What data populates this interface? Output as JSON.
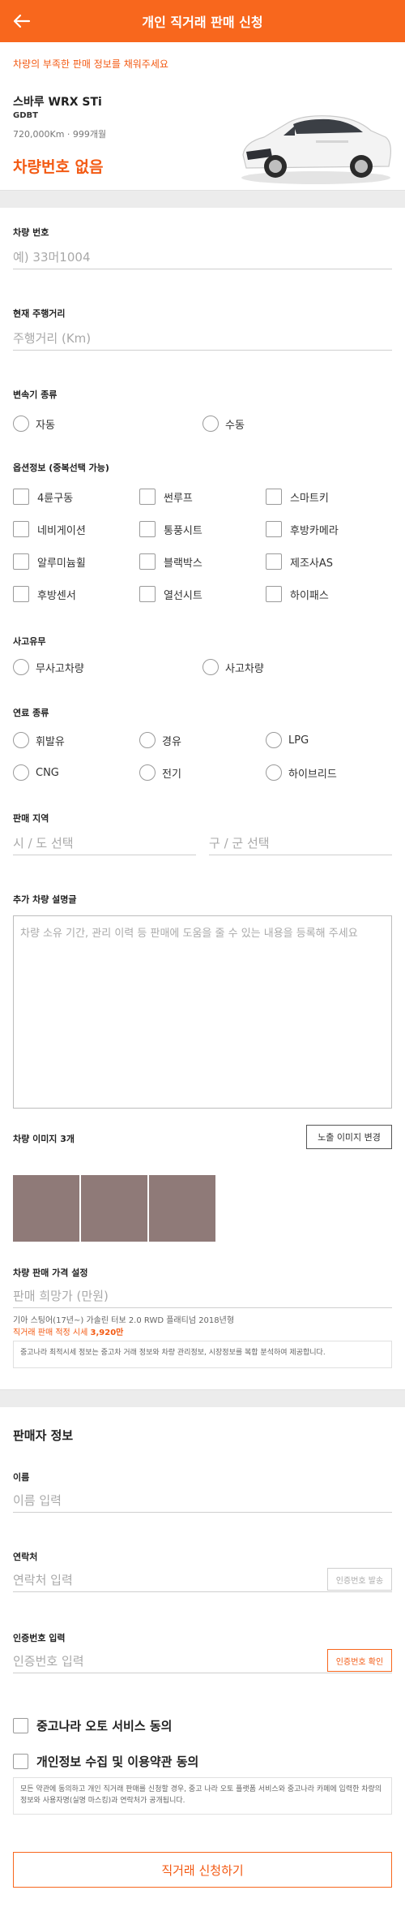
{
  "header": {
    "title": "개인 직거래 판매 신청"
  },
  "notice": "차량의 부족한 판매 정보를 채워주세요",
  "car": {
    "name": "스바루 WRX STi",
    "code": "GDBT",
    "meta": "720,000Km · 999개월",
    "plate_status": "차량번호 없음"
  },
  "form": {
    "plate": {
      "label": "차량 번호",
      "placeholder": "예) 33머1004"
    },
    "mileage": {
      "label": "현재 주행거리",
      "placeholder": "주행거리 (Km)"
    },
    "transmission": {
      "label": "변속기 종류",
      "options": [
        "자동",
        "수동"
      ]
    },
    "options": {
      "label": "옵션정보 (중복선택 가능)",
      "items": [
        "4륜구동",
        "썬루프",
        "스마트키",
        "네비게이션",
        "통풍시트",
        "후방카메라",
        "알루미늄휠",
        "블랙박스",
        "제조사AS",
        "후방센서",
        "열선시트",
        "하이패스"
      ]
    },
    "accident": {
      "label": "사고유무",
      "options": [
        "무사고차량",
        "사고차량"
      ]
    },
    "fuel": {
      "label": "연료 종류",
      "options": [
        "휘발유",
        "경유",
        "LPG",
        "CNG",
        "전기",
        "하이브리드"
      ]
    },
    "region": {
      "label": "판매 지역",
      "city_placeholder": "시 / 도 선택",
      "district_placeholder": "구 / 군 선택"
    },
    "description": {
      "label": "추가 차량 설명글",
      "placeholder": "차량 소유 기간, 관리 이력 등 판매에 도움을 줄 수 있는 내용을 등록해 주세요"
    },
    "images": {
      "label": "차량 이미지 3개",
      "change_button": "노출 이미지 변경"
    },
    "price": {
      "label": "차량 판매 가격 설정",
      "placeholder": "판매 희망가 (만원)",
      "model_line": "기아 스팅어(17년~) 가솔린 터보 2.0 RWD 플래티넘 2018년형",
      "recommended_prefix": "직거래 판매 적정 시세",
      "recommended_value": "3,920만",
      "info": "중고나라 최적시세 정보는 중고차 거래 정보와 차량 관리정보, 시장정보를 복합 분석하여 제공합니다."
    }
  },
  "seller": {
    "title": "판매자 정보",
    "name": {
      "label": "이름",
      "placeholder": "이름 입력"
    },
    "phone": {
      "label": "연락처",
      "placeholder": "연락처 입력",
      "button": "인증번호 발송"
    },
    "code": {
      "label": "인증번호 입력",
      "placeholder": "인증번호 입력",
      "button": "인증번호 확인"
    }
  },
  "agreements": {
    "service": "중고나라 오토 서비스 동의",
    "privacy": "개인정보 수집 및 이용약관 동의",
    "info": "모든 약관에 동의하고 개인 직거래 판매를 신청할 경우, 중고 나라 오토 플랫폼 서비스와 중고나라 카페에 입력한 차량의 정보와 사용자명(실명 마스킹)과 연락처가 공개됩니다."
  },
  "submit": "직거래 신청하기",
  "colors": {
    "accent": "#f8671d",
    "accent_text": "#f35a13"
  }
}
